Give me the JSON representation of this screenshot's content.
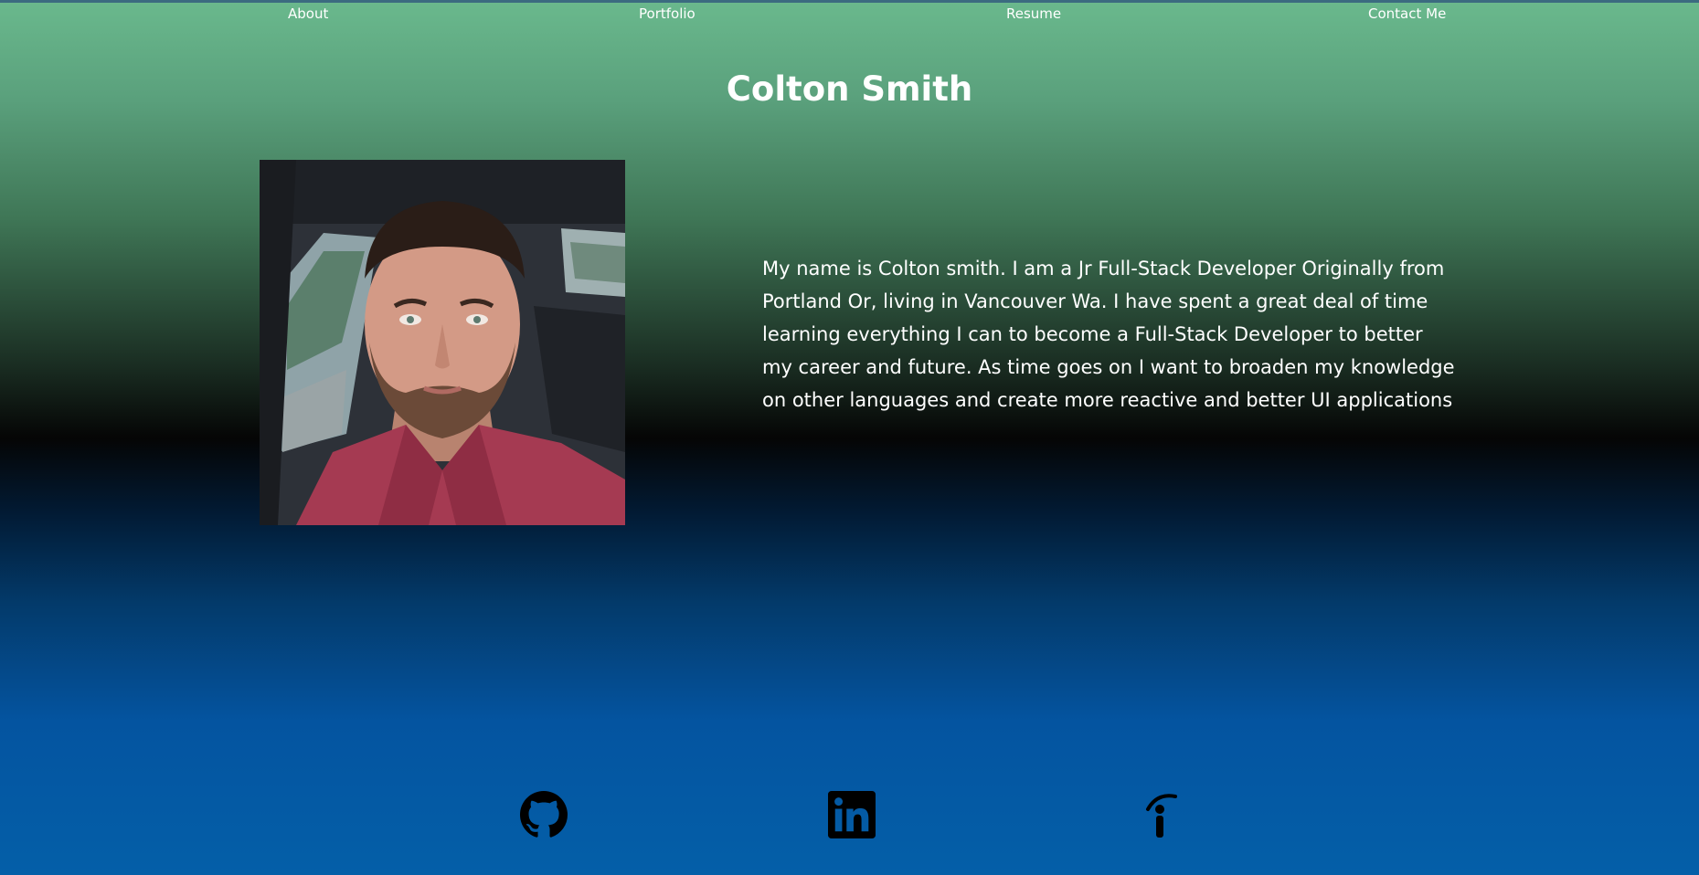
{
  "nav": {
    "items": [
      {
        "label": "About"
      },
      {
        "label": "Portfolio"
      },
      {
        "label": "Resume"
      },
      {
        "label": "Contact Me"
      }
    ]
  },
  "header": {
    "title": "Colton Smith"
  },
  "about": {
    "bio": "My name is Colton smith. I am a Jr Full-Stack Developer Originally from Portland Or, living in Vancouver Wa. I have spent a great deal of time learning everything I can to become a Full-Stack Developer to better my career and future. As time goes on I want to broaden my knowledge on other languages and create more reactive and better UI applications",
    "photo_icon": "profile-photo"
  },
  "footer": {
    "links": [
      {
        "icon": "github-icon"
      },
      {
        "icon": "linkedin-icon"
      },
      {
        "icon": "indeed-icon"
      }
    ]
  },
  "colors": {
    "gradient_top": "#6ab98d",
    "gradient_middle": "#050505",
    "gradient_bottom": "#045fa8",
    "text": "#ffffff"
  }
}
